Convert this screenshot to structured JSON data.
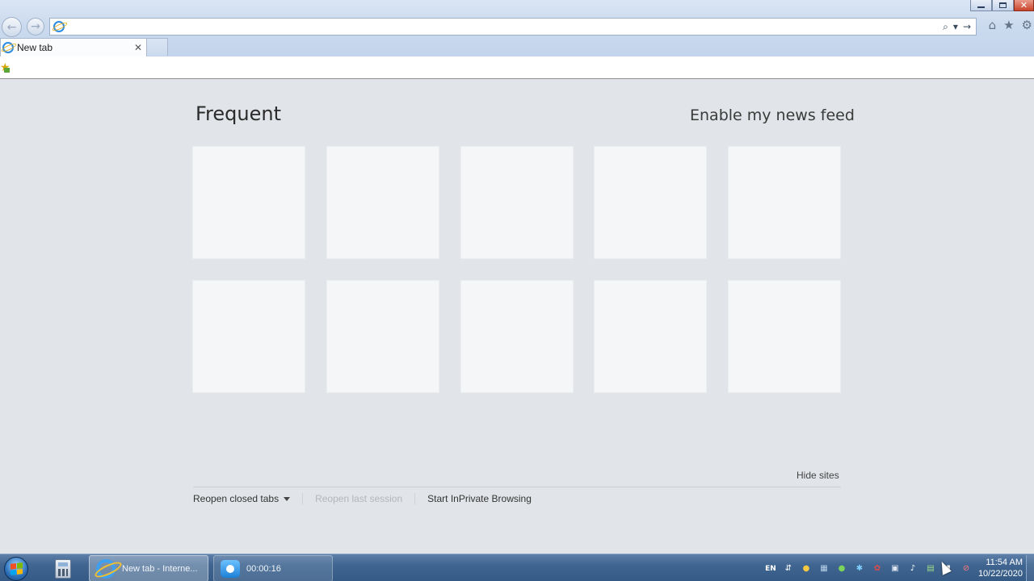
{
  "browser": {
    "address": {
      "value": "",
      "placeholder": ""
    },
    "tabs": [
      {
        "label": "New tab"
      }
    ],
    "icons": {
      "back": "back-arrow-icon",
      "forward": "forward-arrow-icon",
      "search": "search-icon",
      "go": "go-arrow-icon",
      "home": "home-icon",
      "favorites": "favorites-star-icon",
      "tools": "gear-icon"
    }
  },
  "newtab": {
    "frequent_title": "Frequent",
    "news_feed_link": "Enable my news feed",
    "tile_count": 10,
    "hide_sites": "Hide sites",
    "reopen_closed_tabs": "Reopen closed tabs",
    "reopen_last_session": "Reopen last session",
    "start_inprivate": "Start InPrivate Browsing"
  },
  "taskbar": {
    "ie_task": "New tab - Interne...",
    "recorder_task": "00:00:16",
    "language": "EN",
    "time": "11:54 AM",
    "date": "10/22/2020"
  },
  "colors": {
    "page_bg": "#e1e4e8",
    "tile_bg": "#f5f6f7",
    "chrome_bg": "#cbdaee",
    "taskbar_bg": "#3f6590"
  }
}
